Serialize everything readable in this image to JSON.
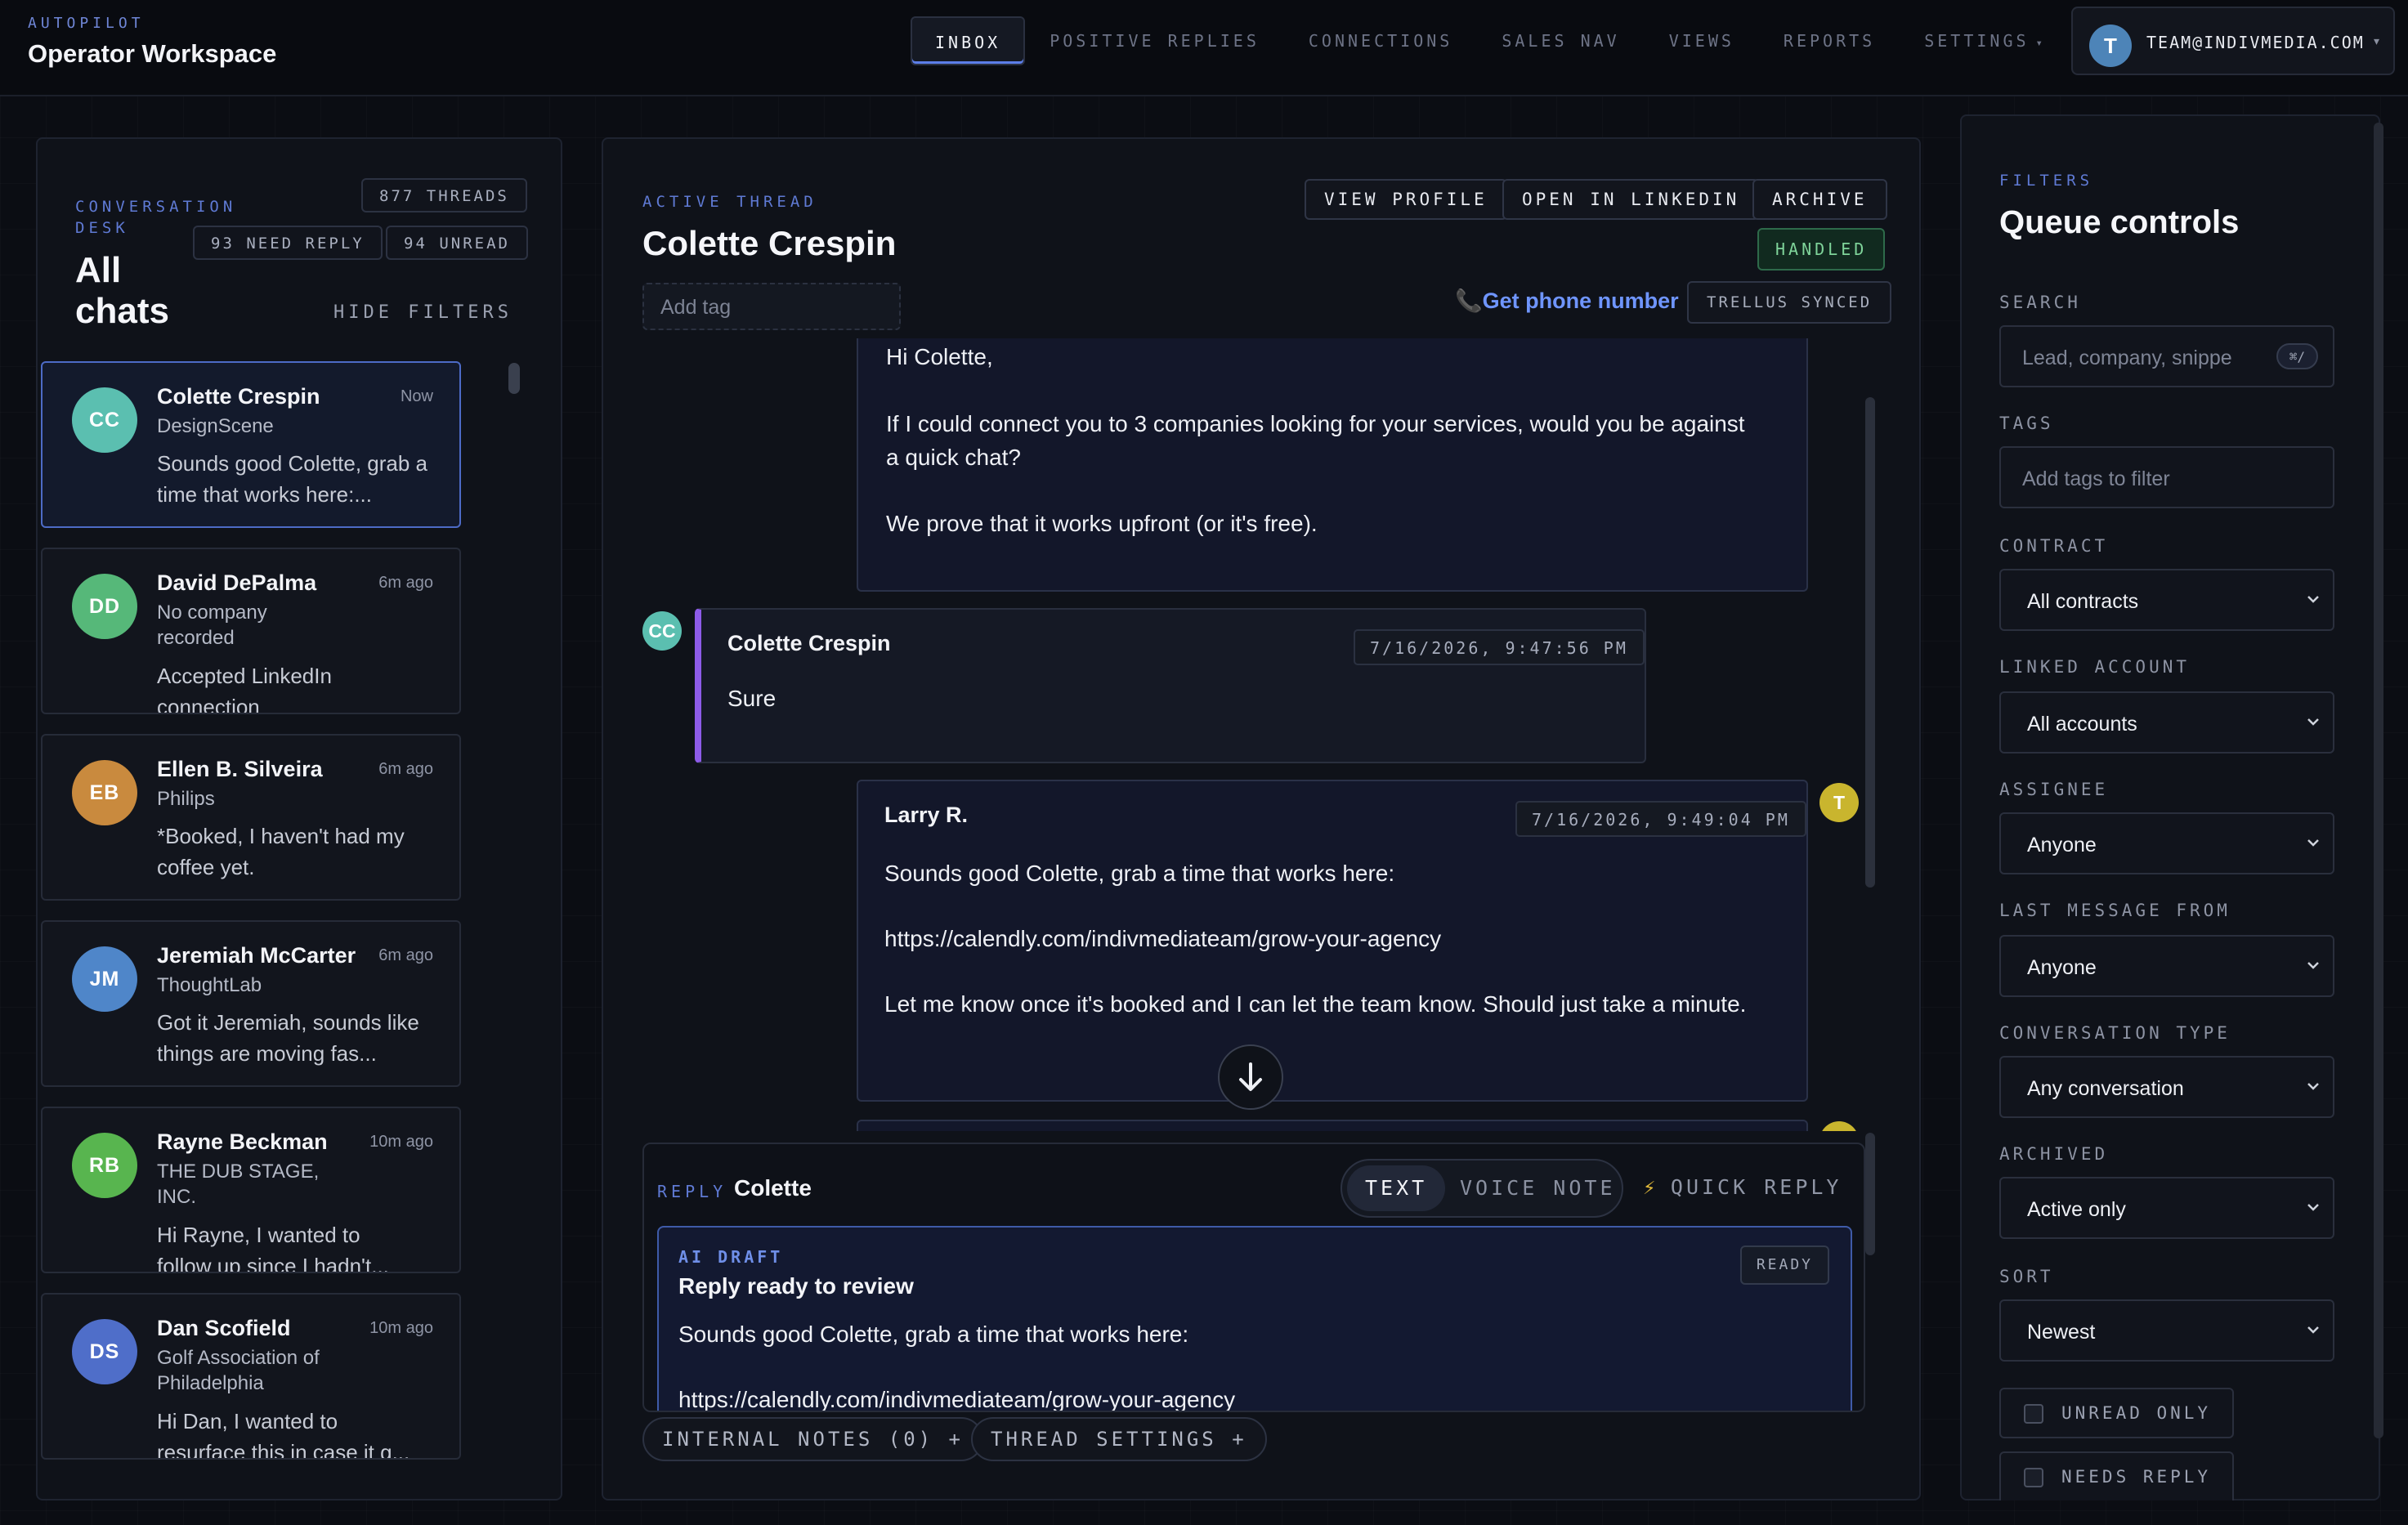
{
  "header": {
    "kicker": "AUTOPILOT",
    "title": "Operator Workspace",
    "nav": [
      {
        "label": "INBOX",
        "active": true
      },
      {
        "label": "POSITIVE REPLIES"
      },
      {
        "label": "CONNECTIONS"
      },
      {
        "label": "SALES NAV"
      },
      {
        "label": "VIEWS"
      },
      {
        "label": "REPORTS"
      },
      {
        "label": "SETTINGS"
      }
    ],
    "account": {
      "initial": "T",
      "email": "TEAM@INDIVMEDIA.COM"
    }
  },
  "left": {
    "kicker": "CONVERSATION DESK",
    "kicker_line1": "CONVERSATION",
    "kicker_line2": "DESK",
    "title_line1": "All",
    "title_line2": "chats",
    "threads": "877 THREADS",
    "need_reply": "93 NEED REPLY",
    "unread": "94 UNREAD",
    "hide_filters": "HIDE FILTERS",
    "chats": [
      {
        "initials": "CC",
        "name": "Colette Crespin",
        "company": "DesignScene",
        "time": "Now",
        "snippet": "Sounds good Colette, grab a time that works here:...",
        "color": "#5bbfb0"
      },
      {
        "initials": "DD",
        "name": "David DePalma",
        "company": "No company recorded",
        "time": "6m ago",
        "snippet": "Accepted LinkedIn connection",
        "color": "#56b879"
      },
      {
        "initials": "EB",
        "name": "Ellen B. Silveira",
        "company": "Philips",
        "time": "6m ago",
        "snippet": "*Booked, I haven't had my coffee yet.",
        "color": "#c98a3e"
      },
      {
        "initials": "JM",
        "name": "Jeremiah McCarter",
        "company": "ThoughtLab",
        "time": "6m ago",
        "snippet": "Got it Jeremiah, sounds like things are moving fas...",
        "color": "#4f86c9"
      },
      {
        "initials": "RB",
        "name": "Rayne Beckman",
        "company": "THE DUB STAGE, INC.",
        "time": "10m ago",
        "snippet": "Hi Rayne, I wanted to follow up since I hadn't...",
        "color": "#58b54f"
      },
      {
        "initials": "DS",
        "name": "Dan Scofield",
        "company": "Golf Association of Philadelphia",
        "time": "10m ago",
        "snippet": "Hi Dan, I wanted to resurface this in case it g...",
        "color": "#4f6ec9"
      }
    ]
  },
  "thread": {
    "kicker": "ACTIVE THREAD",
    "name": "Colette Crespin",
    "actions": [
      "VIEW PROFILE",
      "OPEN IN LINKEDIN",
      "ARCHIVE"
    ],
    "status": "HANDLED",
    "tag_placeholder": "Add tag",
    "phone_link": "Get phone number",
    "synced": "TRELLUS SYNCED",
    "messages": [
      {
        "lines": [
          "Hi Colette,",
          "If I could connect you to 3 companies looking for your services, would you be against a quick chat?",
          "We prove that it works upfront (or it's free)."
        ]
      },
      {
        "sender": "Colette Crespin",
        "initials": "CC",
        "timestamp": "7/16/2026, 9:47:56 PM",
        "lines": [
          "Sure"
        ]
      },
      {
        "sender": "Larry R.",
        "initials": "T",
        "timestamp": "7/16/2026, 9:49:04 PM",
        "lines": [
          "Sounds good Colette, grab a time that works here:",
          "https://calendly.com/indivmediateam/grow-your-agency",
          "Let me know once it's booked and I can let the team know. Should just take a minute."
        ]
      }
    ],
    "reply": {
      "kicker": "REPLY",
      "to": "Colette",
      "modes": [
        "TEXT",
        "VOICE NOTE"
      ],
      "quick_reply": "QUICK REPLY",
      "ai_kicker": "AI DRAFT",
      "ai_title": "Reply ready to review",
      "ai_status": "READY",
      "draft_lines": [
        "Sounds good Colette, grab a time that works here:",
        "https://calendly.com/indivmediateam/grow-your-agency"
      ]
    },
    "footer": [
      "INTERNAL NOTES (0) +",
      "THREAD SETTINGS +"
    ]
  },
  "filters": {
    "kicker": "FILTERS",
    "title": "Queue controls",
    "search_label": "SEARCH",
    "search_placeholder": "Lead, company, snippe",
    "search_shortcut": "⌘/",
    "tags_label": "TAGS",
    "tags_placeholder": "Add tags to filter",
    "selects": [
      {
        "label": "CONTRACT",
        "value": "All contracts"
      },
      {
        "label": "LINKED ACCOUNT",
        "value": "All accounts"
      },
      {
        "label": "ASSIGNEE",
        "value": "Anyone"
      },
      {
        "label": "LAST MESSAGE FROM",
        "value": "Anyone"
      },
      {
        "label": "CONVERSATION TYPE",
        "value": "Any conversation"
      },
      {
        "label": "ARCHIVED",
        "value": "Active only"
      },
      {
        "label": "SORT",
        "value": "Newest"
      }
    ],
    "checks": [
      "UNREAD ONLY",
      "NEEDS REPLY"
    ]
  },
  "colors": {
    "accent": "#5c7ee8",
    "handled": "#7fd49a",
    "draft_border": "#3f5ba8",
    "colette_bar": "#8d5be8",
    "larry_avatar": "#c9b52e"
  }
}
